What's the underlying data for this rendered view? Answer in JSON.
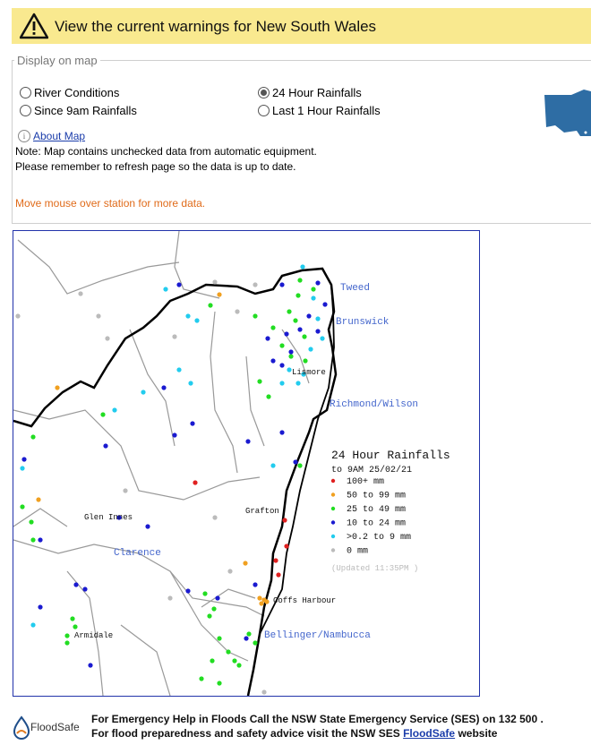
{
  "warning": {
    "text": "View the current warnings for New South Wales"
  },
  "panel": {
    "legend": "Display on map",
    "options": [
      {
        "label": "River Conditions",
        "selected": false
      },
      {
        "label": "Since 9am Rainfalls",
        "selected": false
      },
      {
        "label": "24 Hour Rainfalls",
        "selected": true
      },
      {
        "label": "Last 1 Hour Rainfalls",
        "selected": false
      }
    ],
    "about_link": "About Map",
    "note1": "Note: Map contains unchecked data from automatic equipment.",
    "note2": "Please remember to refresh page so the data is up to date.",
    "hover_hint": "Move mouse over station for more data."
  },
  "map": {
    "places": [
      {
        "name": "Lismore"
      },
      {
        "name": "Glen Innes"
      },
      {
        "name": "Grafton"
      },
      {
        "name": "Coffs Harbour"
      },
      {
        "name": "Armidale"
      }
    ],
    "basins": [
      {
        "name": "Tweed"
      },
      {
        "name": "Brunswick"
      },
      {
        "name": "Richmond/Wilson"
      },
      {
        "name": "Clarence"
      },
      {
        "name": "Bellinger/Nambucca"
      }
    ],
    "legend": {
      "title": "24 Hour Rainfalls",
      "subtitle": "to 9AM 25/02/21",
      "items": [
        {
          "label": "100+ mm",
          "color": "#e02020"
        },
        {
          "label": "50  to 99 mm",
          "color": "#f0a020"
        },
        {
          "label": "25  to 49 mm",
          "color": "#22dd22"
        },
        {
          "label": "10  to 24 mm",
          "color": "#1a1ad0"
        },
        {
          "label": ">0.2 to 9 mm",
          "color": "#22ccee"
        },
        {
          "label": "0 mm",
          "color": "#bbbbbb"
        }
      ],
      "updated": "(Updated 11:35PM  )"
    }
  },
  "footer": {
    "logo_text": "FloodSafe",
    "line1": "For Emergency Help in Floods Call the NSW State Emergency Service (SES) on 132 500 .",
    "line2_pre": "For flood preparedness and safety advice visit the NSW SES ",
    "line2_link": "FloodSafe",
    "line2_post": " website"
  }
}
